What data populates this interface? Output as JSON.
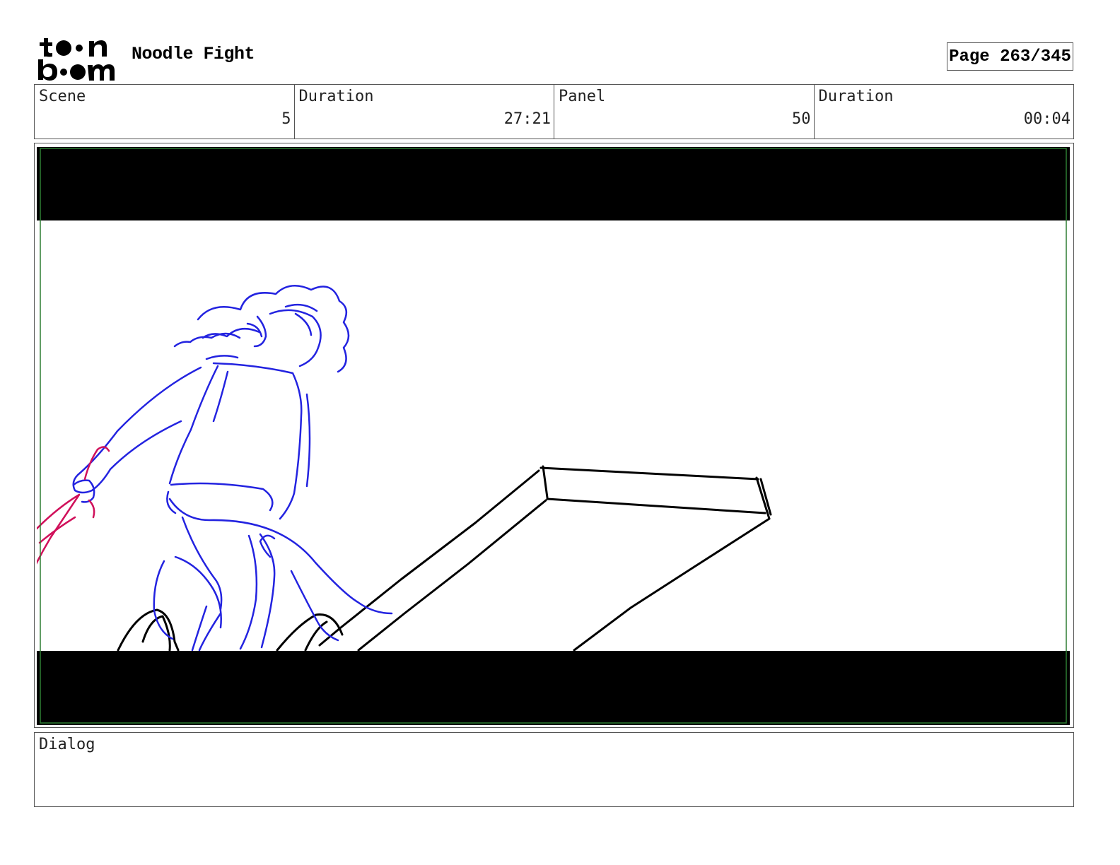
{
  "header": {
    "logo_text": "toon boom",
    "project_title": "Noodle Fight",
    "page_label": "Page 263/345"
  },
  "info": {
    "scene_label": "Scene",
    "scene_value": "5",
    "scene_duration_label": "Duration",
    "scene_duration_value": "27:21",
    "panel_label": "Panel",
    "panel_value": "50",
    "panel_duration_label": "Duration",
    "panel_duration_value": "00:04"
  },
  "dialog": {
    "label": "Dialog",
    "text": ""
  },
  "colors": {
    "letterbox": "#000000",
    "safe_frame": "#2e7d32",
    "character_sketch": "#2323e0",
    "prop_sketch": "#d0105a",
    "line_art": "#000000"
  }
}
